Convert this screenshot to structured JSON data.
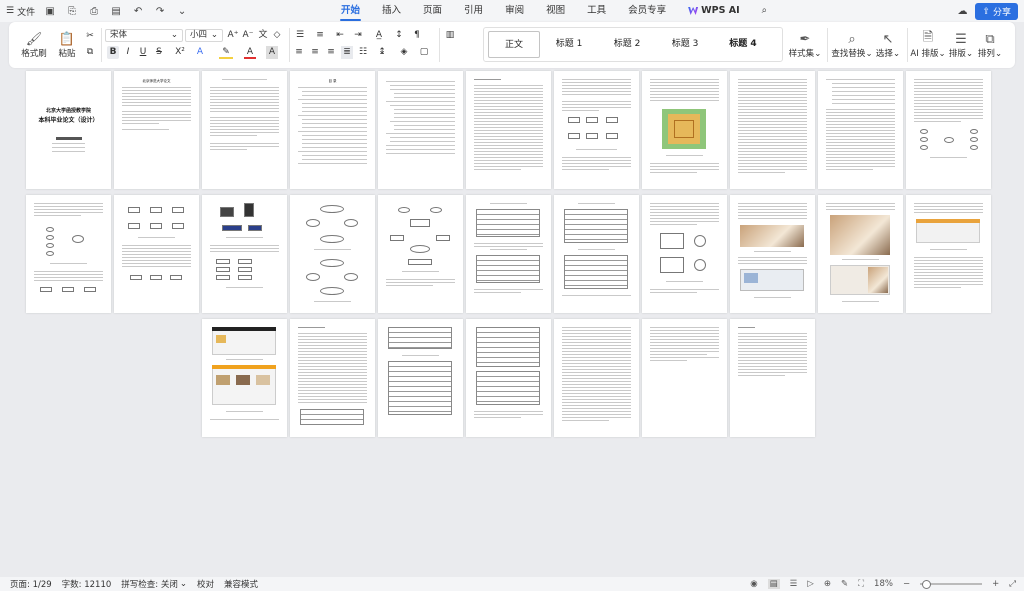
{
  "menubar": {
    "file_label": "文件",
    "tabs": [
      "开始",
      "插入",
      "页面",
      "引用",
      "审阅",
      "视图",
      "工具",
      "会员专享"
    ],
    "active_tab": "开始",
    "wps_ai_label": "WPS AI",
    "share_label": "分享"
  },
  "ribbon": {
    "format_painter_label": "格式刷",
    "paste_label": "粘贴",
    "font_name": "宋体",
    "font_size": "小四",
    "style_label": "样式集",
    "find_replace_label": "查找替换",
    "select_label": "选择",
    "ai_layout_label": "AI 排版",
    "layout_label": "排版",
    "arrange_label": "排列",
    "styles": [
      "正文",
      "标题 1",
      "标题 2",
      "标题 3",
      "标题 4"
    ],
    "bold_label": "B",
    "italic_label": "I",
    "underline_label": "U",
    "strike_label": "S",
    "sup_label": "X²",
    "font_grow_label": "A⁺",
    "font_shrink_label": "A⁻",
    "text_effect_label": "A",
    "font_color_label": "A",
    "char_shade_label": "A"
  },
  "pages": {
    "cover_school": "北京大学函授教学院",
    "cover_title": "本科毕业论文（设计）",
    "p2_title": "北京师范大学论文",
    "p4_title": "目 录"
  },
  "status": {
    "page": "页面: 1/29",
    "words": "字数: 12110",
    "spell": "拼写检查: 关闭",
    "proof": "校对",
    "compat": "兼容模式",
    "zoom": "18%"
  }
}
